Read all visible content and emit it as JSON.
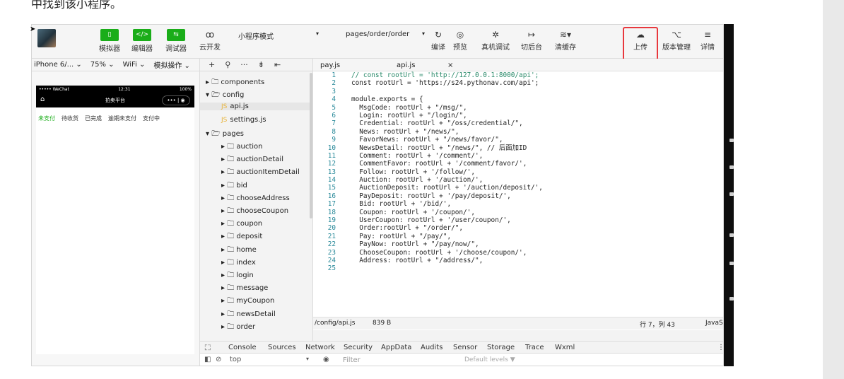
{
  "doc": {
    "heading": "中找到该小程序。"
  },
  "toolbar": {
    "simulator": "模拟器",
    "editor": "编辑器",
    "debugger": "调试器",
    "cloud": "云开发",
    "mode": "小程序模式",
    "page": "pages/order/order",
    "compile": "编译",
    "preview": "预览",
    "real_debug": "真机调试",
    "background": "切后台",
    "clear_cache": "清缓存",
    "upload": "上传",
    "version": "版本管理",
    "details": "详情"
  },
  "sim": {
    "device": "iPhone 6/...",
    "zoom": "75%",
    "network": "WiFi",
    "ops": "模拟操作",
    "status_left": "••••• WeChat",
    "status_time": "12:31",
    "status_battery": "100%",
    "nav_title": "拍卖平台",
    "tabs": [
      "未支付",
      "待收货",
      "已完成",
      "逾期未支付",
      "支付中"
    ]
  },
  "tree": {
    "items": [
      {
        "label": "components",
        "indent": 0,
        "kind": "folder-closed"
      },
      {
        "label": "config",
        "indent": 0,
        "kind": "folder-open"
      },
      {
        "label": "api.js",
        "indent": 1,
        "kind": "file"
      },
      {
        "label": "settings.js",
        "indent": 1,
        "kind": "file"
      },
      {
        "label": "pages",
        "indent": 0,
        "kind": "folder-open"
      },
      {
        "label": "auction",
        "indent": 1,
        "kind": "folder-closed"
      },
      {
        "label": "auctionDetail",
        "indent": 1,
        "kind": "folder-closed"
      },
      {
        "label": "auctionItemDetail",
        "indent": 1,
        "kind": "folder-closed"
      },
      {
        "label": "bid",
        "indent": 1,
        "kind": "folder-closed"
      },
      {
        "label": "chooseAddress",
        "indent": 1,
        "kind": "folder-closed"
      },
      {
        "label": "chooseCoupon",
        "indent": 1,
        "kind": "folder-closed"
      },
      {
        "label": "coupon",
        "indent": 1,
        "kind": "folder-closed"
      },
      {
        "label": "deposit",
        "indent": 1,
        "kind": "folder-closed"
      },
      {
        "label": "home",
        "indent": 1,
        "kind": "folder-closed"
      },
      {
        "label": "index",
        "indent": 1,
        "kind": "folder-closed"
      },
      {
        "label": "login",
        "indent": 1,
        "kind": "folder-closed"
      },
      {
        "label": "message",
        "indent": 1,
        "kind": "folder-closed"
      },
      {
        "label": "myCoupon",
        "indent": 1,
        "kind": "folder-closed"
      },
      {
        "label": "newsDetail",
        "indent": 1,
        "kind": "folder-closed"
      },
      {
        "label": "order",
        "indent": 1,
        "kind": "folder-closed"
      }
    ]
  },
  "editor": {
    "tabs": [
      "pay.js",
      "api.js"
    ],
    "close_glyph": "×",
    "lines": [
      "// const rootUrl = 'http://127.0.0.1:8000/api';",
      "const rootUrl = 'https://s24.pythonav.com/api';",
      "",
      "module.exports = {",
      "  MsgCode: rootUrl + \"/msg/\",",
      "  Login: rootUrl + \"/login/\",",
      "  Credential: rootUrl + \"/oss/credential/\",",
      "  News: rootUrl + \"/news/\",",
      "  FavorNews: rootUrl + \"/news/favor/\",",
      "  NewsDetail: rootUrl + \"/news/\", // 后面加ID",
      "  Comment: rootUrl + '/comment/',",
      "  CommentFavor: rootUrl + '/comment/favor/',",
      "  Follow: rootUrl + '/follow/',",
      "  Auction: rootUrl + '/auction/',",
      "  AuctionDeposit: rootUrl + '/auction/deposit/',",
      "  PayDeposit: rootUrl + '/pay/deposit/',",
      "  Bid: rootUrl + '/bid/',",
      "  Coupon: rootUrl + '/coupon/',",
      "  UserCoupon: rootUrl + '/user/coupon/',",
      "  Order:rootUrl + \"/order/\",",
      "  Pay: rootUrl + \"/pay/\",",
      "  PayNow: rootUrl + \"/pay/now/\",",
      "  ChooseCoupon: rootUrl + '/choose/coupon/',",
      "  Address: rootUrl + \"/address/\",",
      ""
    ],
    "status_path": "/config/api.js",
    "status_size": "839 B",
    "status_pos": "行 7，列 43",
    "status_lang": "JavaSc"
  },
  "console": {
    "tabs": [
      "Console",
      "Sources",
      "Network",
      "Security",
      "AppData",
      "Audits",
      "Sensor",
      "Storage",
      "Trace",
      "Wxml"
    ],
    "context": "top",
    "filter_placeholder": "Filter",
    "levels": "Default levels ▼"
  },
  "colors": {
    "accent_green": "#1aad19",
    "highlight_red": "#e8383d"
  }
}
